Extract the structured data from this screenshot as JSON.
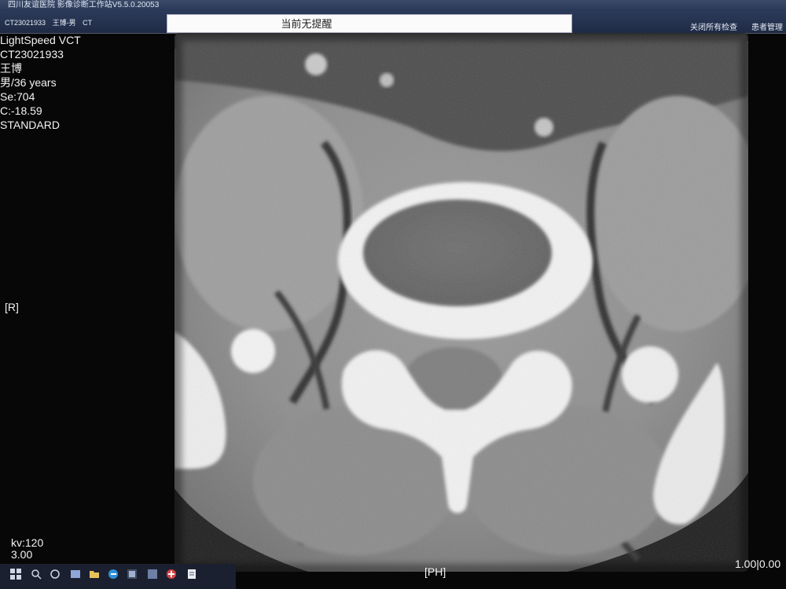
{
  "window": {
    "title": "四川友谊医院 影像诊断工作站V5.5.0.20053",
    "patient_tab": {
      "study_id": "CT23021933",
      "name": "王博-男",
      "modality": "CT"
    },
    "reminder": "当前无提醒",
    "close_all_label": "关闭所有检查",
    "patient_mgmt_label": "患者管理"
  },
  "overlay": {
    "device": "LightSpeed VCT",
    "study_id": "CT23021933",
    "patient_name": "王博",
    "sex_age": "男/36 years",
    "series": "Se:704",
    "wc": "C:-18.59",
    "kernel": "STANDARD",
    "orientation_left": "[R]",
    "orientation_bottom": "[PH]",
    "kv": "kv:120",
    "slice_thickness": "3.00",
    "zoom": "1.00|0.00"
  },
  "colors": {
    "titlebar": "#2a3857",
    "overlay_text": "#f2f2f2",
    "reminder_bg": "#fbfbfb"
  },
  "taskbar": {
    "icons": [
      "windows-icon",
      "search-icon",
      "task-view-icon",
      "edge-icon",
      "folder-icon",
      "store-icon",
      "app-icon",
      "app-icon-2",
      "app-icon-3"
    ]
  }
}
